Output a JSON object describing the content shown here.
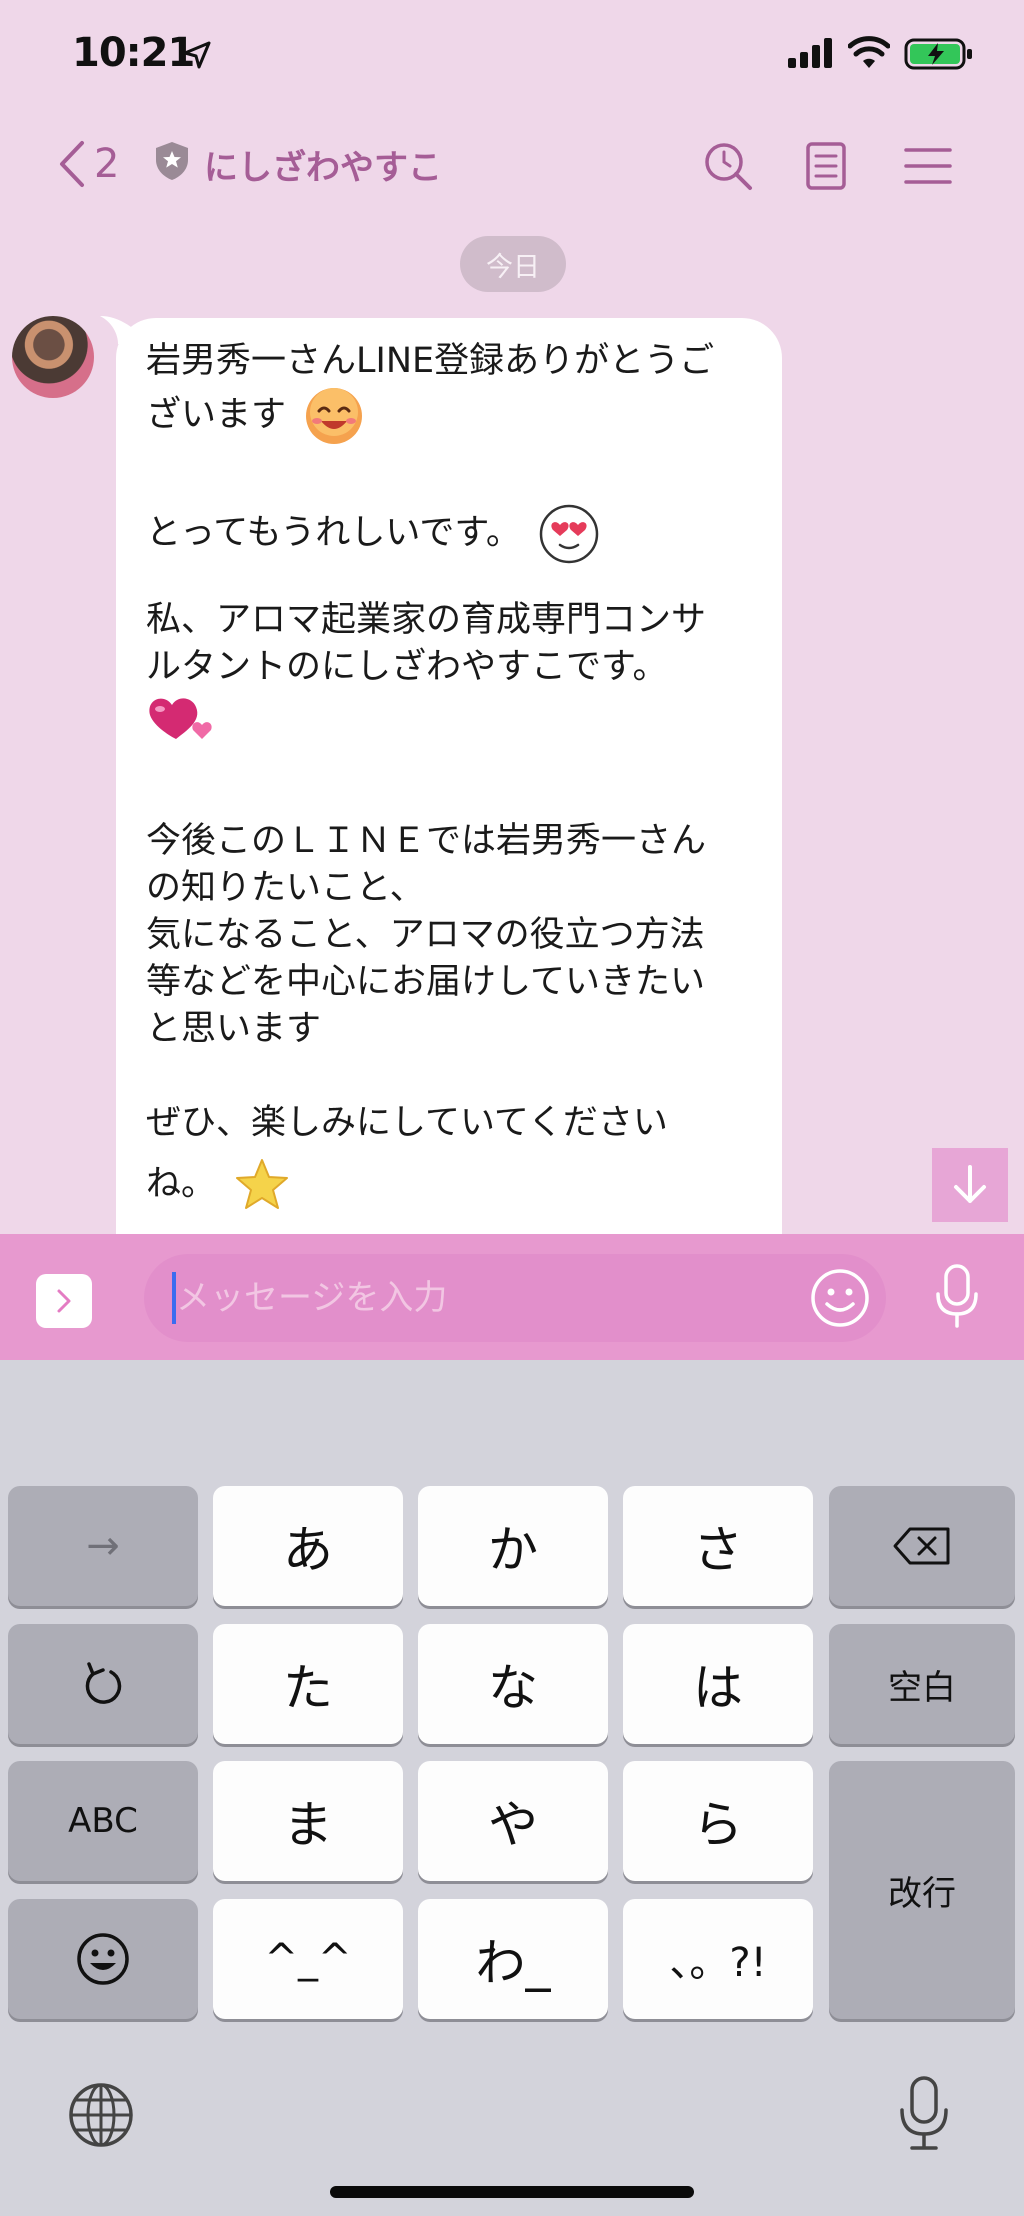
{
  "status_bar": {
    "time": "10:21"
  },
  "header": {
    "back_count": "2",
    "title": "にしざわやすこ"
  },
  "date_separator": "今日",
  "message": {
    "lines": [
      "岩男秀一さんLINE登録ありがとうご",
      "ざいます",
      "",
      "とってもうれしいです。",
      "",
      "私、アロマ起業家の育成専門コンサ",
      "ルタントのにしざわやすこです。",
      "",
      "",
      "今後このＬＩＮＥでは岩男秀一さん",
      "の知りたいこと、",
      "気になること、アロマの役立つ方法",
      "等などを中心にお届けしていきたい",
      "と思います",
      "",
      "ぜひ、楽しみにしていてください",
      "ね。"
    ]
  },
  "input": {
    "placeholder": "メッセージを入力"
  },
  "keyboard": {
    "arrow": "→",
    "a": "あ",
    "ka": "か",
    "sa": "さ",
    "ta": "た",
    "na": "な",
    "ha": "は",
    "space": "空白",
    "abc": "ABC",
    "ma": "ま",
    "ya": "や",
    "ra": "ら",
    "enter": "改行",
    "kaomoji": "^_^",
    "wa": "わ_",
    "punct": "、。?!"
  },
  "colors": {
    "chat_bg": "#efd7e9",
    "accent": "#a55d96",
    "input_bar": "#e799cf"
  }
}
